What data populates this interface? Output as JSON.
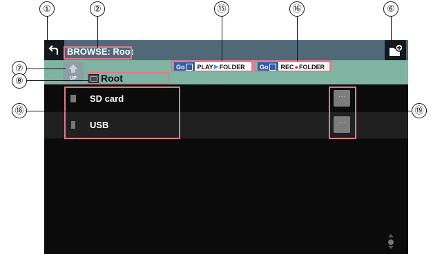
{
  "screen": {
    "title": "BROWSE: Root",
    "breadcrumb": "Root",
    "up_label": "UP",
    "shortcuts": [
      {
        "go": "Go",
        "label_a": "PLAY",
        "sep": "▶",
        "label_b": "FOLDER"
      },
      {
        "go": "Go",
        "label_a": "REC",
        "sep": "●",
        "label_b": "FOLDER"
      }
    ],
    "rows": [
      {
        "label": "SD card",
        "more": "···"
      },
      {
        "label": "USB",
        "more": "···"
      }
    ]
  },
  "callouts": [
    "①",
    "②",
    "⑥",
    "⑦",
    "⑧",
    "⑮",
    "⑯",
    "⑱",
    "⑲"
  ],
  "colors": {
    "title_bar": "#4f6979",
    "sub_bar": "#7fb4a2",
    "screen_bg": "#0b0b0b",
    "highlight_marker": "#e07a8c",
    "go_badge": "#2e5fa8"
  },
  "icons": [
    "back-arrow-icon",
    "new-folder-icon",
    "up-folder-icon",
    "folder-icon",
    "sd-card-icon",
    "usb-icon",
    "scroll-indicator-icon"
  ]
}
